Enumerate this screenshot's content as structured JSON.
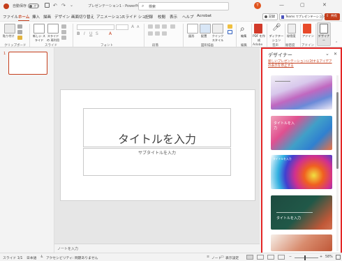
{
  "titlebar": {
    "autosave": "自動保存",
    "autosave_state": "オフ",
    "doc_title": "プレゼンテーション1 - PowerPoint",
    "search_placeholder": "検索",
    "user_initial": "T",
    "record": "記録",
    "teams_share": "Teams でプレゼンテーション",
    "share": "共有"
  },
  "tabs": [
    "ファイル",
    "ホーム",
    "挿入",
    "描画",
    "デザイン",
    "画面切り替え",
    "アニメーション",
    "スライド ショー",
    "記録",
    "校閲",
    "表示",
    "ヘルプ",
    "Acrobat"
  ],
  "ribbon": {
    "paste": "貼り付け",
    "new_slide": "新しい スライド",
    "reuse_slides": "スライドの 再利用",
    "groups": {
      "clipboard": "クリップボード",
      "slides": "スライド",
      "font": "フォント",
      "paragraph": "段落",
      "drawing": "図形描画",
      "editing": "編集",
      "adobe": "Adobe",
      "voice": "音声",
      "sensitivity": "秘密度",
      "addins": "アドイン",
      "designer": "デザイナー"
    },
    "shapes": "図形",
    "arrange": "配置",
    "quick_styles": "クイック スタイル",
    "editing_btn": "編集",
    "pdf": "PDF を作成",
    "dictate": "ディクテーション",
    "sensitivity_btn": "秘密度",
    "addins_btn": "アドイン",
    "designer_btn": "デザイナー"
  },
  "slide": {
    "number": "1",
    "title": "タイトルを入力",
    "subtitle": "サブタイトルを入力"
  },
  "notes_label": "ノートを入力",
  "designer": {
    "header": "デザイナー",
    "link": "新しいプレゼンテーションに対するアイデアの表示を停止する",
    "design2_text": "タイトルを入力",
    "design3_text": "タイトルを入力",
    "design4_text": "タイトルを入力"
  },
  "status": {
    "slide_count": "スライド 1/1",
    "language": "日本語",
    "accessibility": "アクセシビリティ: 問題ありません",
    "notes": "ノート",
    "display_settings": "表示設定",
    "zoom": "58%"
  },
  "colors": {
    "accent": "#c43e1c",
    "designer_border": "#e32525"
  }
}
